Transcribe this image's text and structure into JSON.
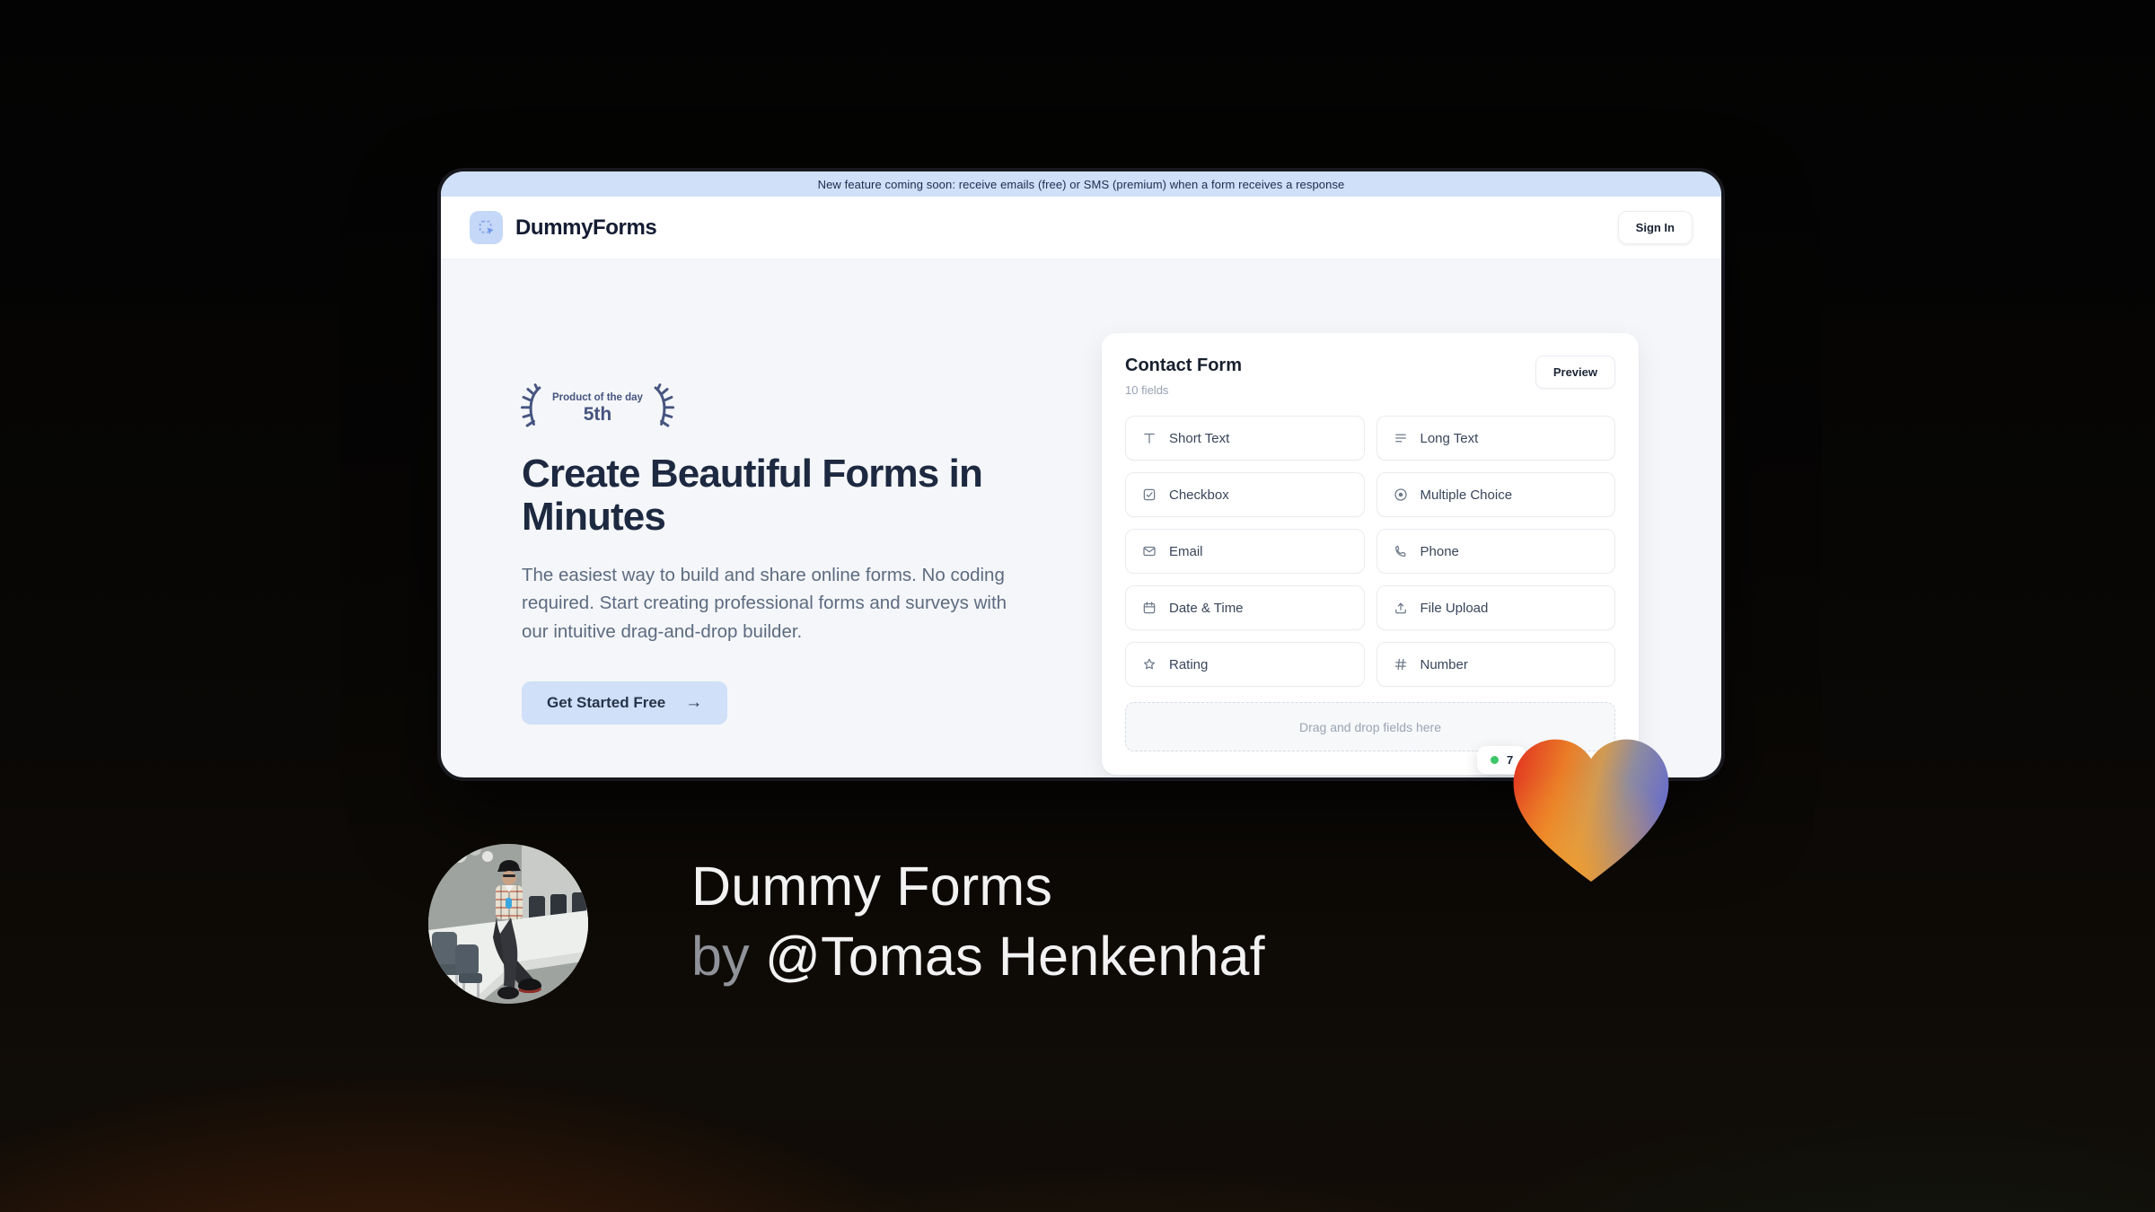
{
  "banner": {
    "text": "New feature coming soon: receive emails (free) or SMS (premium) when a form receives a response"
  },
  "header": {
    "brand": "DummyForms",
    "logo_icon": "dashed-select-cursor-icon",
    "sign_in_label": "Sign In"
  },
  "hero": {
    "award": {
      "label": "Product of the day",
      "rank": "5th",
      "left_icon": "laurel-left-icon",
      "right_icon": "laurel-right-icon"
    },
    "title": "Create Beautiful Forms in Minutes",
    "description": "The easiest way to build and share online forms. No coding required. Start creating professional forms and surveys with our intuitive drag-and-drop builder.",
    "cta_label": "Get Started Free",
    "cta_icon": "arrow-right-icon"
  },
  "builder": {
    "title": "Contact Form",
    "subtitle": "10 fields",
    "preview_label": "Preview",
    "fields": [
      {
        "label": "Short Text",
        "icon": "short-text-icon"
      },
      {
        "label": "Long Text",
        "icon": "long-text-icon"
      },
      {
        "label": "Checkbox",
        "icon": "checkbox-icon"
      },
      {
        "label": "Multiple Choice",
        "icon": "radio-icon"
      },
      {
        "label": "Email",
        "icon": "email-icon"
      },
      {
        "label": "Phone",
        "icon": "phone-icon"
      },
      {
        "label": "Date & Time",
        "icon": "calendar-icon"
      },
      {
        "label": "File Upload",
        "icon": "upload-icon"
      },
      {
        "label": "Rating",
        "icon": "star-icon"
      },
      {
        "label": "Number",
        "icon": "hash-icon"
      }
    ],
    "dropzone_text": "Drag and drop fields here",
    "response_badge": {
      "visible_text": "7",
      "dot_color": "#3ec768"
    }
  },
  "caption": {
    "line1": "Dummy Forms",
    "by": "by",
    "author": "@Tomas Henkenhaf"
  },
  "colors": {
    "banner_bg": "#cfe0f8",
    "accent_blue": "#cfe0f8",
    "brand_navy": "#1d2940",
    "text_gray": "#5d6b80",
    "award_blue": "#46547f",
    "green_dot": "#3ec768",
    "heart_gradient": [
      "#e23420",
      "#ea7d27",
      "#8d8ba0",
      "#6b6fc7"
    ],
    "bg_dark_orange": "#7d300c",
    "bg_dark_green": "#084432"
  }
}
